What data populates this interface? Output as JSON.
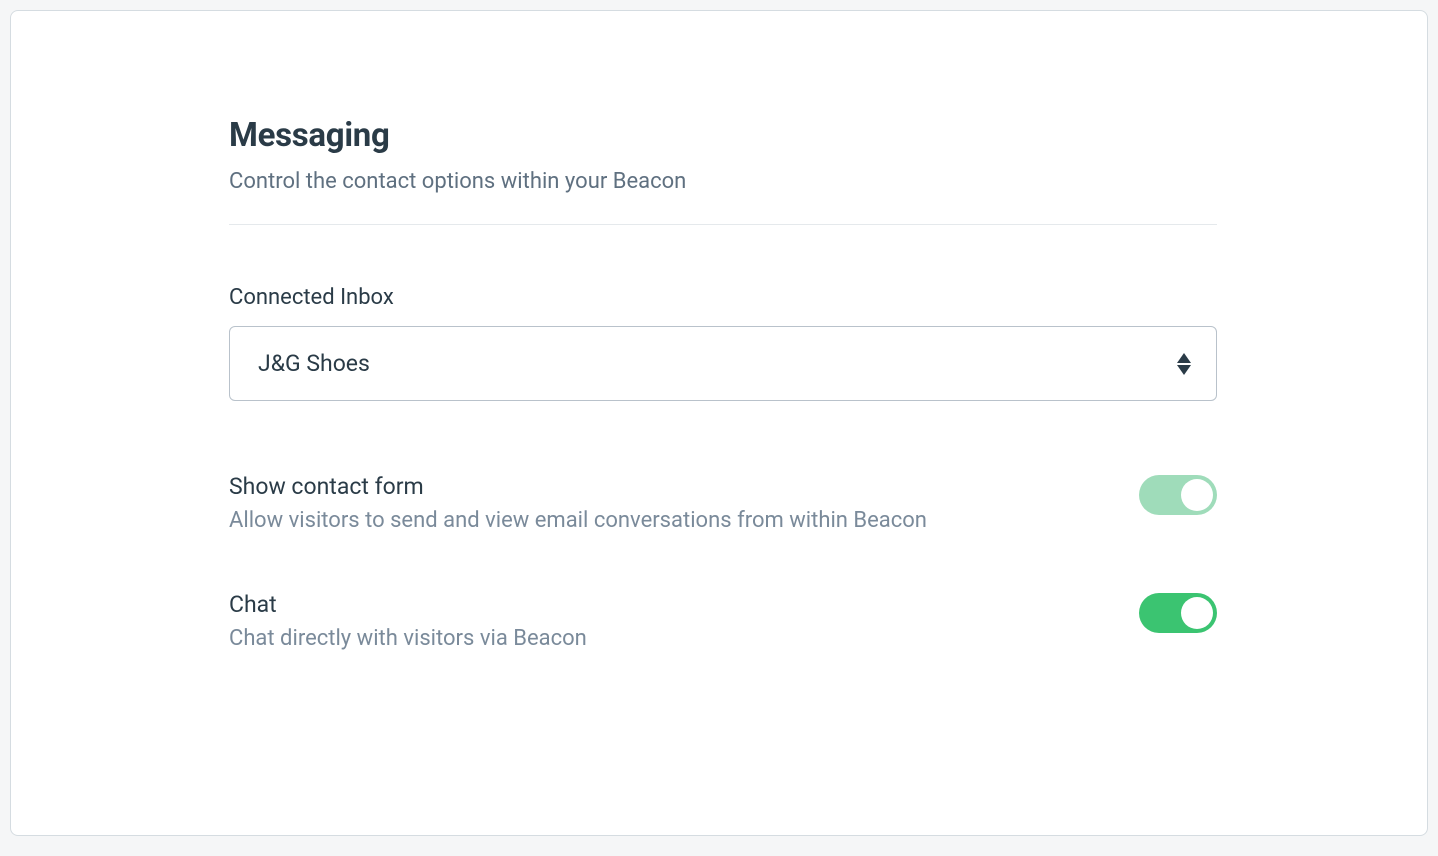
{
  "header": {
    "title": "Messaging",
    "subtitle": "Control the contact options within your Beacon"
  },
  "fields": {
    "connected_inbox": {
      "label": "Connected Inbox",
      "selected": "J&G Shoes"
    }
  },
  "settings": {
    "contact_form": {
      "title": "Show contact form",
      "desc": "Allow visitors to send and view email conversations from within Beacon",
      "enabled": true
    },
    "chat": {
      "title": "Chat",
      "desc": "Chat directly with visitors via Beacon",
      "enabled": true
    }
  }
}
